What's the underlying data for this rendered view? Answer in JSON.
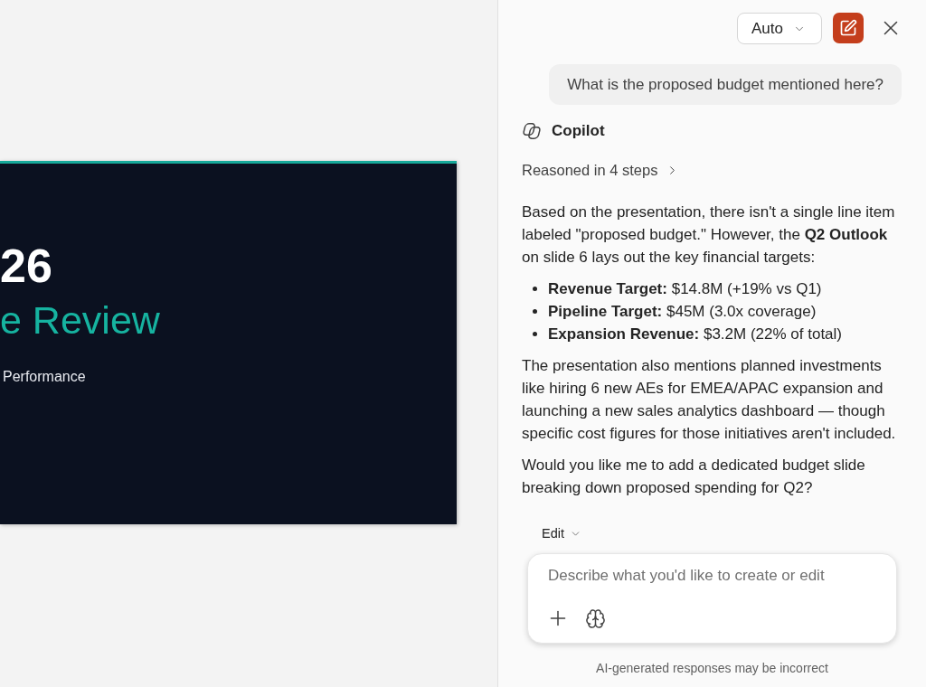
{
  "slide": {
    "lines": [
      {
        "kind": "heading",
        "text": "26"
      },
      {
        "kind": "subheading",
        "text": "e Review"
      },
      {
        "kind": "caption",
        "text": "Performance"
      }
    ]
  },
  "copilot_pane": {
    "mode_dropdown": {
      "label": "Auto"
    },
    "user_message": "What is the proposed budget mentioned here?",
    "response": {
      "author": "Copilot",
      "reasoning": {
        "label": "Reasoned in 4 steps",
        "expanded": false
      },
      "blocks": [
        {
          "kind": "paragraph",
          "text": "Based on the presentation, there isn't a single line item labeled \"proposed budget.\" However, the **Q2 Outlook** on slide 6 lays out the key financial targets:"
        },
        {
          "kind": "list",
          "items": [
            "**Revenue Target:** $14.8M (+19% vs Q1)",
            "**Pipeline Target:** $45M (3.0x coverage)",
            "**Expansion Revenue:** $3.2M (22% of total)"
          ]
        },
        {
          "kind": "paragraph",
          "text": "The presentation also mentions planned investments like hiring 6 new AEs for EMEA/APAC expansion and launching a new sales analytics dashboard — though specific cost figures for those initiatives aren't included."
        },
        {
          "kind": "paragraph",
          "text": "Would you like me to add a dedicated budget slide breaking down proposed spending for Q2?"
        }
      ]
    },
    "composer": {
      "mode": "Edit",
      "placeholder": "Describe what you'd like to create or edit"
    },
    "disclaimer": "AI-generated responses may be incorrect"
  }
}
